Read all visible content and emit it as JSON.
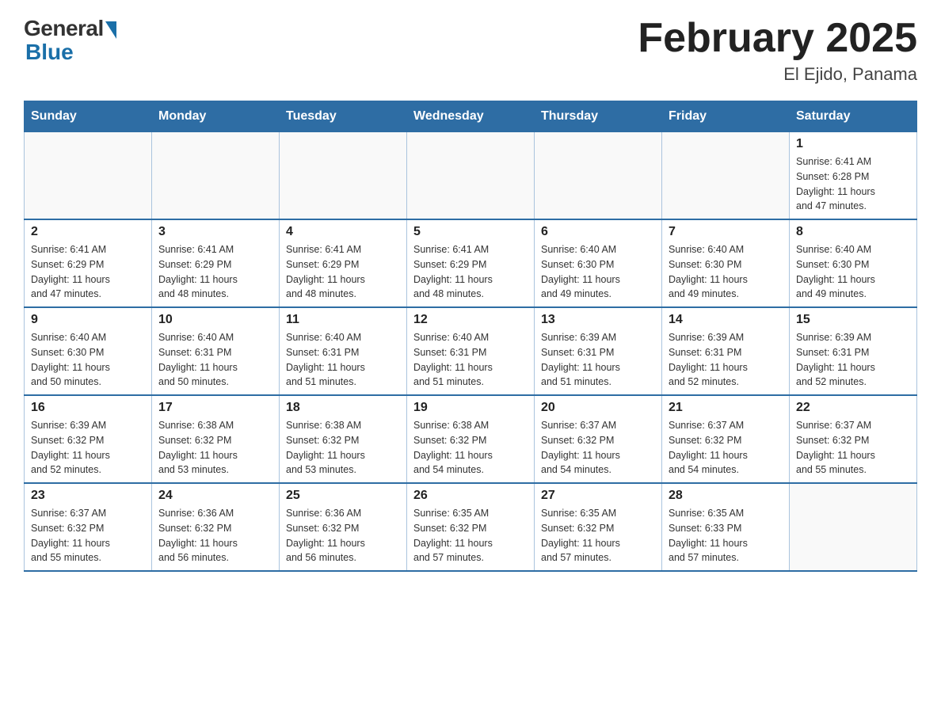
{
  "logo": {
    "general": "General",
    "blue": "Blue"
  },
  "title": "February 2025",
  "location": "El Ejido, Panama",
  "days_of_week": [
    "Sunday",
    "Monday",
    "Tuesday",
    "Wednesday",
    "Thursday",
    "Friday",
    "Saturday"
  ],
  "weeks": [
    [
      {
        "day": "",
        "info": ""
      },
      {
        "day": "",
        "info": ""
      },
      {
        "day": "",
        "info": ""
      },
      {
        "day": "",
        "info": ""
      },
      {
        "day": "",
        "info": ""
      },
      {
        "day": "",
        "info": ""
      },
      {
        "day": "1",
        "info": "Sunrise: 6:41 AM\nSunset: 6:28 PM\nDaylight: 11 hours\nand 47 minutes."
      }
    ],
    [
      {
        "day": "2",
        "info": "Sunrise: 6:41 AM\nSunset: 6:29 PM\nDaylight: 11 hours\nand 47 minutes."
      },
      {
        "day": "3",
        "info": "Sunrise: 6:41 AM\nSunset: 6:29 PM\nDaylight: 11 hours\nand 48 minutes."
      },
      {
        "day": "4",
        "info": "Sunrise: 6:41 AM\nSunset: 6:29 PM\nDaylight: 11 hours\nand 48 minutes."
      },
      {
        "day": "5",
        "info": "Sunrise: 6:41 AM\nSunset: 6:29 PM\nDaylight: 11 hours\nand 48 minutes."
      },
      {
        "day": "6",
        "info": "Sunrise: 6:40 AM\nSunset: 6:30 PM\nDaylight: 11 hours\nand 49 minutes."
      },
      {
        "day": "7",
        "info": "Sunrise: 6:40 AM\nSunset: 6:30 PM\nDaylight: 11 hours\nand 49 minutes."
      },
      {
        "day": "8",
        "info": "Sunrise: 6:40 AM\nSunset: 6:30 PM\nDaylight: 11 hours\nand 49 minutes."
      }
    ],
    [
      {
        "day": "9",
        "info": "Sunrise: 6:40 AM\nSunset: 6:30 PM\nDaylight: 11 hours\nand 50 minutes."
      },
      {
        "day": "10",
        "info": "Sunrise: 6:40 AM\nSunset: 6:31 PM\nDaylight: 11 hours\nand 50 minutes."
      },
      {
        "day": "11",
        "info": "Sunrise: 6:40 AM\nSunset: 6:31 PM\nDaylight: 11 hours\nand 51 minutes."
      },
      {
        "day": "12",
        "info": "Sunrise: 6:40 AM\nSunset: 6:31 PM\nDaylight: 11 hours\nand 51 minutes."
      },
      {
        "day": "13",
        "info": "Sunrise: 6:39 AM\nSunset: 6:31 PM\nDaylight: 11 hours\nand 51 minutes."
      },
      {
        "day": "14",
        "info": "Sunrise: 6:39 AM\nSunset: 6:31 PM\nDaylight: 11 hours\nand 52 minutes."
      },
      {
        "day": "15",
        "info": "Sunrise: 6:39 AM\nSunset: 6:31 PM\nDaylight: 11 hours\nand 52 minutes."
      }
    ],
    [
      {
        "day": "16",
        "info": "Sunrise: 6:39 AM\nSunset: 6:32 PM\nDaylight: 11 hours\nand 52 minutes."
      },
      {
        "day": "17",
        "info": "Sunrise: 6:38 AM\nSunset: 6:32 PM\nDaylight: 11 hours\nand 53 minutes."
      },
      {
        "day": "18",
        "info": "Sunrise: 6:38 AM\nSunset: 6:32 PM\nDaylight: 11 hours\nand 53 minutes."
      },
      {
        "day": "19",
        "info": "Sunrise: 6:38 AM\nSunset: 6:32 PM\nDaylight: 11 hours\nand 54 minutes."
      },
      {
        "day": "20",
        "info": "Sunrise: 6:37 AM\nSunset: 6:32 PM\nDaylight: 11 hours\nand 54 minutes."
      },
      {
        "day": "21",
        "info": "Sunrise: 6:37 AM\nSunset: 6:32 PM\nDaylight: 11 hours\nand 54 minutes."
      },
      {
        "day": "22",
        "info": "Sunrise: 6:37 AM\nSunset: 6:32 PM\nDaylight: 11 hours\nand 55 minutes."
      }
    ],
    [
      {
        "day": "23",
        "info": "Sunrise: 6:37 AM\nSunset: 6:32 PM\nDaylight: 11 hours\nand 55 minutes."
      },
      {
        "day": "24",
        "info": "Sunrise: 6:36 AM\nSunset: 6:32 PM\nDaylight: 11 hours\nand 56 minutes."
      },
      {
        "day": "25",
        "info": "Sunrise: 6:36 AM\nSunset: 6:32 PM\nDaylight: 11 hours\nand 56 minutes."
      },
      {
        "day": "26",
        "info": "Sunrise: 6:35 AM\nSunset: 6:32 PM\nDaylight: 11 hours\nand 57 minutes."
      },
      {
        "day": "27",
        "info": "Sunrise: 6:35 AM\nSunset: 6:32 PM\nDaylight: 11 hours\nand 57 minutes."
      },
      {
        "day": "28",
        "info": "Sunrise: 6:35 AM\nSunset: 6:33 PM\nDaylight: 11 hours\nand 57 minutes."
      },
      {
        "day": "",
        "info": ""
      }
    ]
  ]
}
